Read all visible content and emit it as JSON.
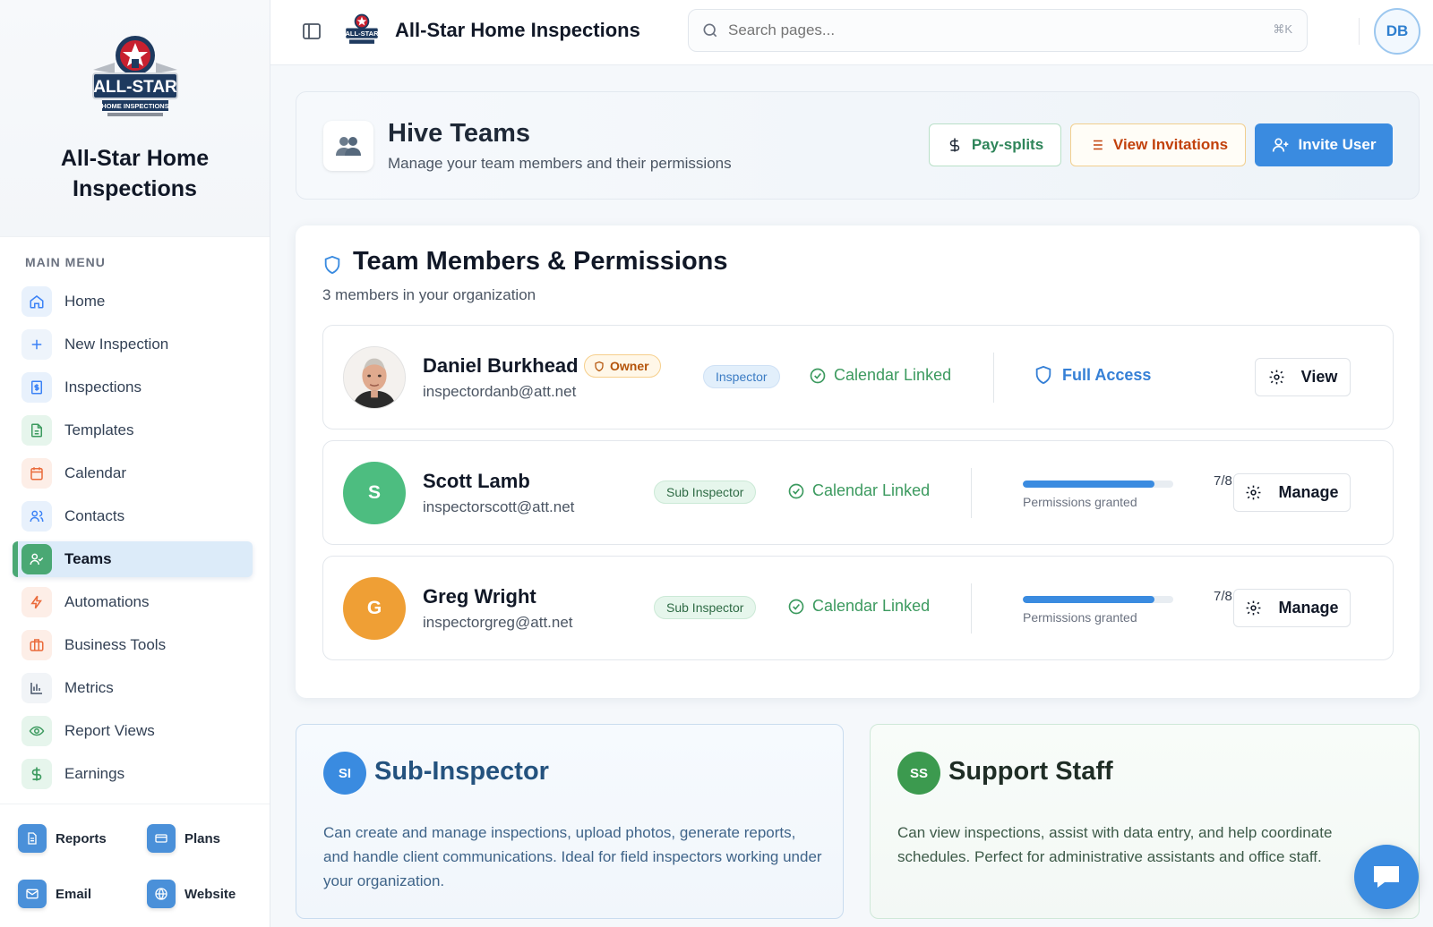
{
  "brand": {
    "name": "All-Star Home Inspections",
    "logo_text": "ALL-STAR",
    "logo_sub": "HOME INSPECTIONS"
  },
  "sidebar": {
    "menu_heading": "MAIN MENU",
    "items": [
      {
        "label": "Home",
        "icon": "home-icon",
        "color": "#3b82f6",
        "bg": "#e8f1fc"
      },
      {
        "label": "New Inspection",
        "icon": "plus-icon",
        "color": "#3b82f6",
        "bg": "#eef4fb"
      },
      {
        "label": "Inspections",
        "icon": "dollar-doc-icon",
        "color": "#3b82f6",
        "bg": "#e8f1fc"
      },
      {
        "label": "Templates",
        "icon": "document-icon",
        "color": "#3c9a5f",
        "bg": "#e6f5ec"
      },
      {
        "label": "Calendar",
        "icon": "calendar-icon",
        "color": "#ea6a3a",
        "bg": "#fdeee7"
      },
      {
        "label": "Contacts",
        "icon": "users-icon",
        "color": "#3b82f6",
        "bg": "#e8f1fc"
      },
      {
        "label": "Teams",
        "icon": "user-check-icon",
        "color": "#ffffff",
        "bg": "#4aa874",
        "active": true
      },
      {
        "label": "Automations",
        "icon": "lightning-icon",
        "color": "#ea6a3a",
        "bg": "#fdeee7"
      },
      {
        "label": "Business Tools",
        "icon": "briefcase-icon",
        "color": "#ea6a3a",
        "bg": "#fdeee7"
      },
      {
        "label": "Metrics",
        "icon": "bar-chart-icon",
        "color": "#475569",
        "bg": "#f1f4f7"
      },
      {
        "label": "Report Views",
        "icon": "eye-icon",
        "color": "#3c9a5f",
        "bg": "#e6f5ec"
      },
      {
        "label": "Earnings",
        "icon": "dollar-icon",
        "color": "#3c9a5f",
        "bg": "#e6f5ec"
      }
    ],
    "quick_links": [
      {
        "label": "Reports",
        "icon": "report-icon"
      },
      {
        "label": "Plans",
        "icon": "card-icon"
      },
      {
        "label": "Email",
        "icon": "mail-icon"
      },
      {
        "label": "Website",
        "icon": "globe-icon"
      }
    ]
  },
  "header": {
    "title": "All-Star Home Inspections",
    "search_placeholder": "Search pages...",
    "search_shortcut": "⌘K",
    "user_initials": "DB"
  },
  "page": {
    "title": "Hive Teams",
    "subtitle": "Manage your team members and their permissions",
    "actions": {
      "paysplits": "Pay-splits",
      "invitations": "View Invitations",
      "invite": "Invite User"
    }
  },
  "team": {
    "title": "Team Members & Permissions",
    "subtitle": "3 members in your organization",
    "members": [
      {
        "name": "Daniel Burkhead",
        "email": "inspectordanb@att.net",
        "badge": "Owner",
        "role": "Inspector",
        "calendar": "Calendar Linked",
        "access": "Full Access",
        "action": "View"
      },
      {
        "name": "Scott Lamb",
        "email": "inspectorscott@att.net",
        "initial": "S",
        "avatar_color": "#4dbd80",
        "role": "Sub Inspector",
        "calendar": "Calendar Linked",
        "permissions_fraction": "7/8",
        "permissions_granted": 0.875,
        "permissions_label": "Permissions granted",
        "action": "Manage"
      },
      {
        "name": "Greg Wright",
        "email": "inspectorgreg@att.net",
        "initial": "G",
        "avatar_color": "#ef9f35",
        "role": "Sub Inspector",
        "calendar": "Calendar Linked",
        "permissions_fraction": "7/8",
        "permissions_granted": 0.875,
        "permissions_label": "Permissions granted",
        "action": "Manage"
      }
    ]
  },
  "roles": [
    {
      "abbr": "SI",
      "title": "Sub-Inspector",
      "color": "#3a8be0",
      "title_color": "#24527e",
      "text_color": "#3f6489",
      "description": "Can create and manage inspections, upload photos, generate reports, and handle client communications. Ideal for field inspectors working under your organization."
    },
    {
      "abbr": "SS",
      "title": "Support Staff",
      "color": "#3c9a4f",
      "title_color": "#1f2d25",
      "text_color": "#3d5a48",
      "description": "Can view inspections, assist with data entry, and help coordinate schedules. Perfect for administrative assistants and office staff."
    }
  ]
}
